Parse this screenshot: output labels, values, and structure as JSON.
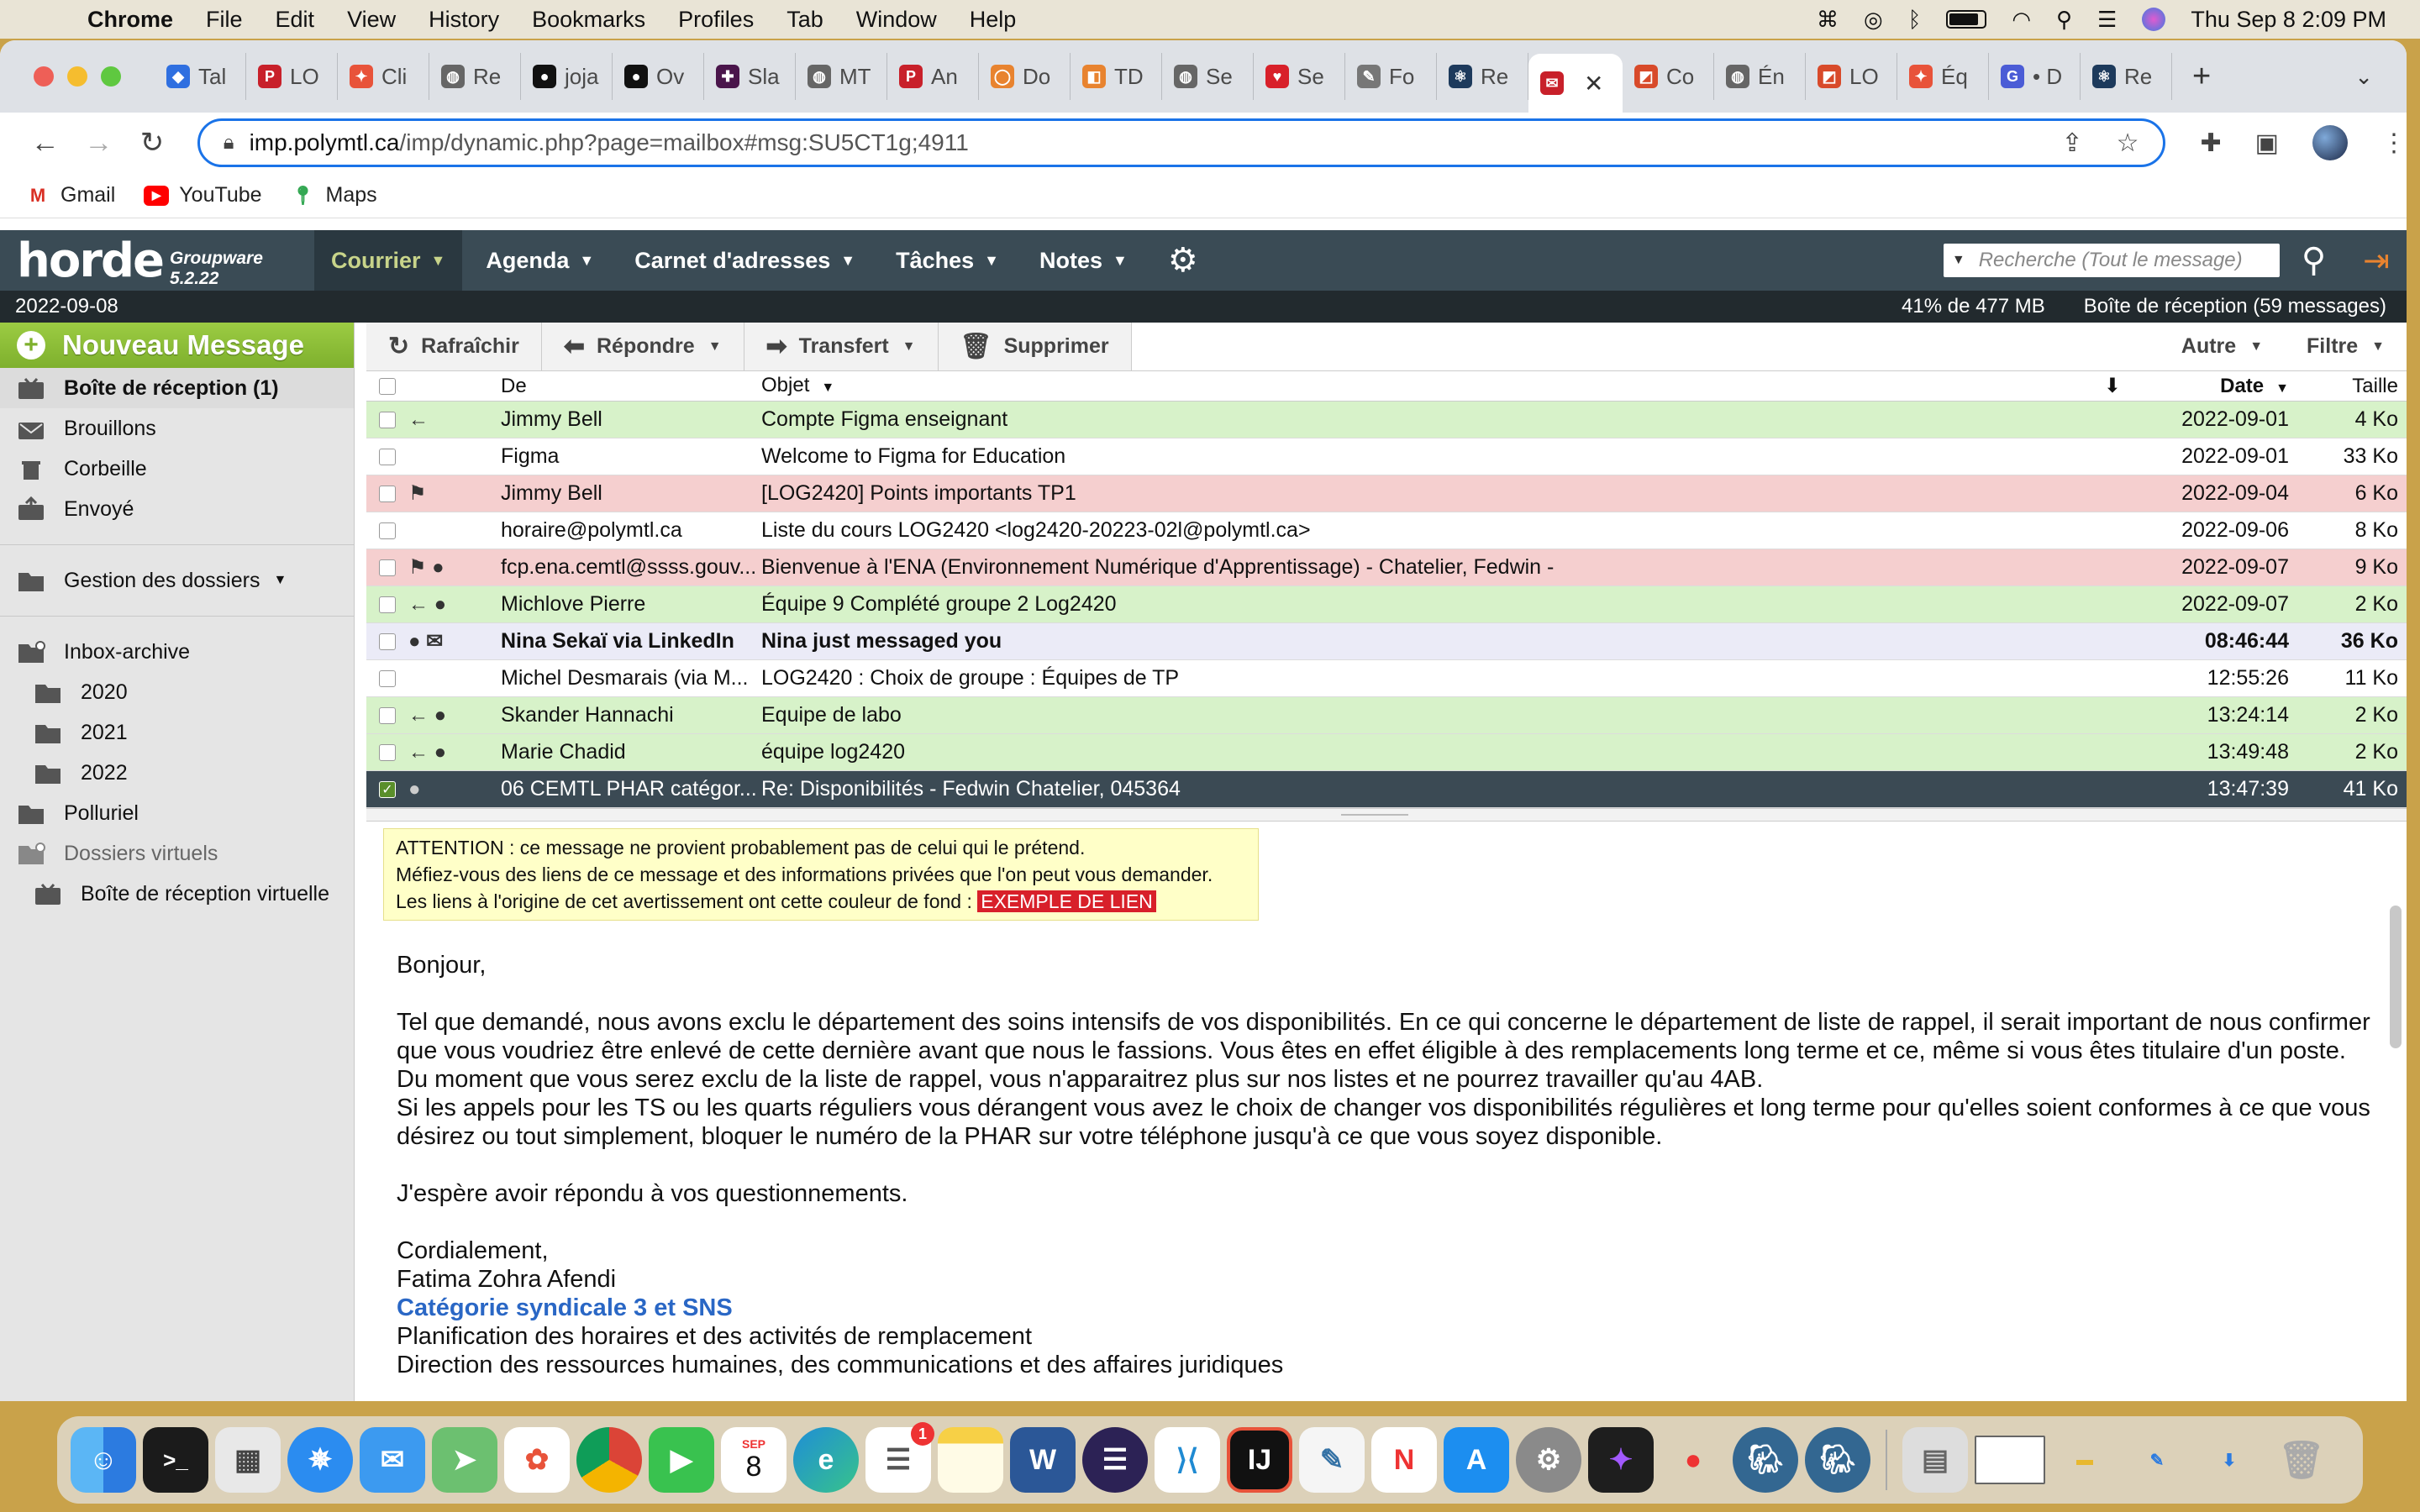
{
  "menubar": {
    "app": "Chrome",
    "items": [
      "File",
      "Edit",
      "View",
      "History",
      "Bookmarks",
      "Profiles",
      "Tab",
      "Window",
      "Help"
    ],
    "datetime": "Thu Sep 8  2:09 PM"
  },
  "tabs": [
    {
      "label": "Tal",
      "color": "#2f6fe0",
      "glyph": "◆"
    },
    {
      "label": "LO",
      "color": "#c8202a",
      "glyph": "P"
    },
    {
      "label": "Cli",
      "color": "#e8533a",
      "glyph": "✦"
    },
    {
      "label": "Re",
      "color": "#666666",
      "glyph": "◍"
    },
    {
      "label": "joja",
      "color": "#111111",
      "glyph": "●"
    },
    {
      "label": "Ov",
      "color": "#111111",
      "glyph": "●"
    },
    {
      "label": "Sla",
      "color": "#4a154b",
      "glyph": "✚"
    },
    {
      "label": "MT",
      "color": "#666666",
      "glyph": "◍"
    },
    {
      "label": "An",
      "color": "#c8202a",
      "glyph": "P"
    },
    {
      "label": "Do",
      "color": "#e8832f",
      "glyph": "◯"
    },
    {
      "label": "TD",
      "color": "#e8832f",
      "glyph": "◧"
    },
    {
      "label": "Se",
      "color": "#666666",
      "glyph": "◍"
    },
    {
      "label": "Se",
      "color": "#d8202a",
      "glyph": "♥"
    },
    {
      "label": "Fo",
      "color": "#777777",
      "glyph": "✎"
    },
    {
      "label": "Re",
      "color": "#1d3a5c",
      "glyph": "⚛"
    },
    {
      "label": "",
      "color": "#c8202a",
      "glyph": "✉",
      "active": true
    },
    {
      "label": "Co",
      "color": "#d84a2a",
      "glyph": "◩"
    },
    {
      "label": "Én",
      "color": "#666666",
      "glyph": "◍"
    },
    {
      "label": "LO",
      "color": "#d84a2a",
      "glyph": "◩"
    },
    {
      "label": "Éq",
      "color": "#e8533a",
      "glyph": "✦"
    },
    {
      "label": "• D",
      "color": "#4b5cd6",
      "glyph": "G"
    },
    {
      "label": "Re",
      "color": "#1d3a5c",
      "glyph": "⚛"
    }
  ],
  "omnibox": {
    "host": "imp.polymtl.ca",
    "path": "/imp/dynamic.php?page=mailbox#msg:SU5CT1g;4911"
  },
  "bookmarks": [
    {
      "label": "Gmail",
      "icon": "gmail-icon"
    },
    {
      "label": "YouTube",
      "icon": "youtube-icon"
    },
    {
      "label": "Maps",
      "icon": "maps-icon"
    }
  ],
  "horde": {
    "logo": "horde",
    "version": "Groupware 5.2.22",
    "nav": [
      {
        "label": "Courrier",
        "active": true
      },
      {
        "label": "Agenda"
      },
      {
        "label": "Carnet d'adresses"
      },
      {
        "label": "Tâches"
      },
      {
        "label": "Notes"
      }
    ],
    "search_placeholder": "Recherche (Tout le message)",
    "date": "2022-09-08",
    "quota": "41% de 477 MB",
    "inbox_count": "Boîte de réception (59 messages)"
  },
  "sidebar": {
    "new_message": "Nouveau Message",
    "folders": [
      {
        "label": "Boîte de réception (1)",
        "icon": "inbox-icon",
        "selected": true
      },
      {
        "label": "Brouillons",
        "icon": "drafts-icon"
      },
      {
        "label": "Corbeille",
        "icon": "trash-icon"
      },
      {
        "label": "Envoyé",
        "icon": "sent-icon"
      }
    ],
    "manage": "Gestion des dossiers",
    "archive": "Inbox-archive",
    "years": [
      "2020",
      "2021",
      "2022"
    ],
    "spam": "Polluriel",
    "virtual": "Dossiers virtuels",
    "virtual_inbox": "Boîte de réception virtuelle"
  },
  "actions": {
    "refresh": "Rafraîchir",
    "reply": "Répondre",
    "forward": "Transfert",
    "delete": "Supprimer",
    "other": "Autre",
    "filter": "Filtre"
  },
  "columns": {
    "from": "De",
    "subject": "Objet",
    "date": "Date",
    "size": "Taille"
  },
  "messages": [
    {
      "from": "Jimmy Bell",
      "subject": "Compte Figma enseignant",
      "date": "2022-09-01",
      "size": "4 Ko",
      "style": "green",
      "icons": "←"
    },
    {
      "from": "Figma",
      "subject": "Welcome to Figma for Education",
      "date": "2022-09-01",
      "size": "33 Ko",
      "style": "white",
      "icons": ""
    },
    {
      "from": "Jimmy Bell",
      "subject": "[LOG2420] Points importants TP1",
      "date": "2022-09-04",
      "size": "6 Ko",
      "style": "red",
      "icons": "⚑"
    },
    {
      "from": "horaire@polymtl.ca",
      "subject": "Liste du cours LOG2420 <log2420-20223-02l@polymtl.ca>",
      "date": "2022-09-06",
      "size": "8 Ko",
      "style": "white",
      "icons": ""
    },
    {
      "from": "fcp.ena.cemtl@ssss.gouv...",
      "subject": "Bienvenue à l'ENA (Environnement Numérique d'Apprentissage) - Chatelier, Fedwin -",
      "date": "2022-09-07",
      "size": "9 Ko",
      "style": "red",
      "icons": "⚑ ●"
    },
    {
      "from": "Michlove Pierre",
      "subject": "Équipe 9 Complété groupe 2 Log2420",
      "date": "2022-09-07",
      "size": "2 Ko",
      "style": "green",
      "icons": "← ●"
    },
    {
      "from": "Nina Sekaï via LinkedIn",
      "subject": "Nina just messaged you",
      "date": "08:46:44",
      "size": "36 Ko",
      "style": "unread",
      "icons": "● ✉"
    },
    {
      "from": "Michel Desmarais (via M...",
      "subject": "LOG2420 : Choix de groupe : Équipes de TP",
      "date": "12:55:26",
      "size": "11 Ko",
      "style": "white",
      "icons": ""
    },
    {
      "from": "Skander Hannachi",
      "subject": "Equipe de labo",
      "date": "13:24:14",
      "size": "2 Ko",
      "style": "green",
      "icons": "← ●"
    },
    {
      "from": "Marie Chadid",
      "subject": "équipe log2420",
      "date": "13:49:48",
      "size": "2 Ko",
      "style": "green",
      "icons": "← ●"
    },
    {
      "from": "06 CEMTL PHAR catégor...",
      "subject": "Re: Disponibilités - Fedwin Chatelier, 045364",
      "date": "13:47:39",
      "size": "41 Ko",
      "style": "sel",
      "icons": "●"
    }
  ],
  "warning": {
    "line1": "ATTENTION : ce message ne provient probablement pas de celui qui le prétend.",
    "line2": "Méfiez-vous des liens de ce message et des informations privées que l'on peut vous demander.",
    "line3": "Les liens à l'origine de cet avertissement ont cette couleur de fond :",
    "example": "EXEMPLE DE LIEN"
  },
  "body": {
    "greeting": "Bonjour,",
    "para1": "Tel que demandé, nous avons exclu le département des soins intensifs de vos disponibilités. En ce qui concerne le département de liste de rappel, il serait important de nous confirmer que vous voudriez être enlevé de cette dernière avant que nous le fassions. Vous êtes en effet éligible à des remplacements long terme et ce, même si vous êtes titulaire d'un poste. Du moment que vous serez exclu de la liste de rappel, vous n'apparaitrez plus sur nos listes et ne pourrez travailler qu'au 4AB.",
    "para2": "Si les appels pour les TS ou les quarts réguliers vous dérangent vous avez le choix de changer vos disponibilités régulières et long terme pour qu'elles soient conformes à ce que vous désirez ou tout simplement, bloquer le numéro de la PHAR sur votre téléphone jusqu'à ce que vous soyez disponible.",
    "closing_q": "J'espère avoir répondu à vos questionnements.",
    "regards": "Cordialement,",
    "name": "Fatima Zohra Afendi",
    "title": "Catégorie syndicale 3 et SNS",
    "line1": "Planification des horaires et des activités de remplacement",
    "line2": "Direction des ressources humaines, des communications et des affaires juridiques"
  },
  "dock": {
    "calendar_month": "SEP",
    "calendar_day": "8",
    "reminders_badge": "1"
  }
}
